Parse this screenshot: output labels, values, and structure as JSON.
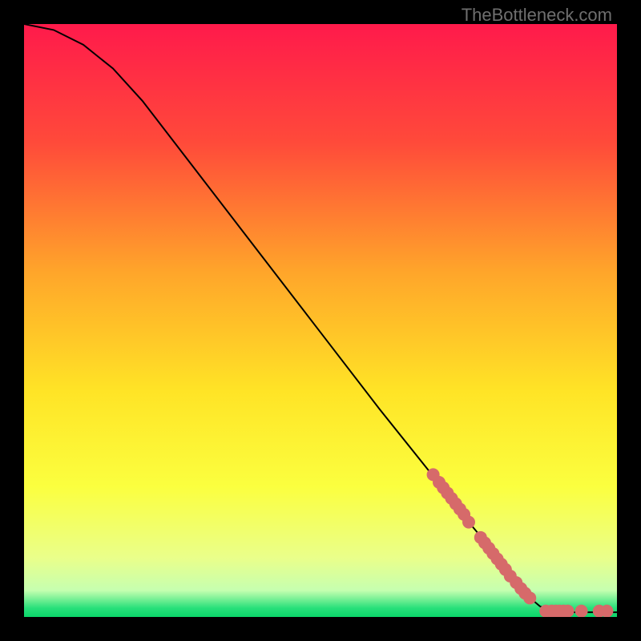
{
  "attribution": "TheBottleneck.com",
  "chart_data": {
    "type": "line",
    "title": "",
    "xlabel": "",
    "ylabel": "",
    "xlim": [
      0,
      100
    ],
    "ylim": [
      0,
      100
    ],
    "gradient_stops": [
      {
        "offset": 0.0,
        "color": "#ff1a4b"
      },
      {
        "offset": 0.2,
        "color": "#ff4a3a"
      },
      {
        "offset": 0.42,
        "color": "#ffa62a"
      },
      {
        "offset": 0.62,
        "color": "#ffe426"
      },
      {
        "offset": 0.78,
        "color": "#fbff3f"
      },
      {
        "offset": 0.9,
        "color": "#eaff8a"
      },
      {
        "offset": 0.955,
        "color": "#c6ffb0"
      },
      {
        "offset": 0.985,
        "color": "#28e07a"
      },
      {
        "offset": 1.0,
        "color": "#0bd66a"
      }
    ],
    "curve": [
      {
        "x": 0,
        "y": 100
      },
      {
        "x": 5,
        "y": 99
      },
      {
        "x": 10,
        "y": 96.5
      },
      {
        "x": 15,
        "y": 92.5
      },
      {
        "x": 20,
        "y": 87
      },
      {
        "x": 30,
        "y": 74
      },
      {
        "x": 40,
        "y": 61
      },
      {
        "x": 50,
        "y": 48
      },
      {
        "x": 60,
        "y": 35
      },
      {
        "x": 70,
        "y": 22.5
      },
      {
        "x": 75,
        "y": 16
      },
      {
        "x": 80,
        "y": 10
      },
      {
        "x": 83,
        "y": 6
      },
      {
        "x": 85,
        "y": 3.5
      },
      {
        "x": 87,
        "y": 1.8
      },
      {
        "x": 89,
        "y": 1
      },
      {
        "x": 92,
        "y": 0.8
      },
      {
        "x": 100,
        "y": 0.8
      }
    ],
    "markers_on_curve": [
      {
        "x": 69,
        "y": 24
      },
      {
        "x": 70,
        "y": 22.7
      },
      {
        "x": 70.7,
        "y": 21.8
      },
      {
        "x": 71.4,
        "y": 20.9
      },
      {
        "x": 72.1,
        "y": 20.0
      },
      {
        "x": 72.8,
        "y": 19.1
      },
      {
        "x": 73.5,
        "y": 18.2
      },
      {
        "x": 74.2,
        "y": 17.3
      },
      {
        "x": 75,
        "y": 16.0
      },
      {
        "x": 77,
        "y": 13.4
      },
      {
        "x": 77.7,
        "y": 12.5
      },
      {
        "x": 78.4,
        "y": 11.6
      },
      {
        "x": 79.1,
        "y": 10.7
      },
      {
        "x": 79.8,
        "y": 9.8
      },
      {
        "x": 80.5,
        "y": 8.9
      },
      {
        "x": 81.2,
        "y": 8.0
      },
      {
        "x": 82,
        "y": 6.9
      },
      {
        "x": 83,
        "y": 5.8
      },
      {
        "x": 83.8,
        "y": 4.8
      },
      {
        "x": 84.5,
        "y": 4.0
      },
      {
        "x": 85.3,
        "y": 3.2
      }
    ],
    "markers_on_baseline": [
      {
        "x": 88,
        "y": 1
      },
      {
        "x": 89,
        "y": 1
      },
      {
        "x": 89.7,
        "y": 1
      },
      {
        "x": 90.3,
        "y": 1
      },
      {
        "x": 91,
        "y": 1
      },
      {
        "x": 91.7,
        "y": 1
      },
      {
        "x": 94,
        "y": 1
      },
      {
        "x": 97,
        "y": 1
      },
      {
        "x": 98.3,
        "y": 1
      }
    ],
    "marker_style": {
      "fill": "#d66a6a",
      "radius_px": 8
    }
  }
}
